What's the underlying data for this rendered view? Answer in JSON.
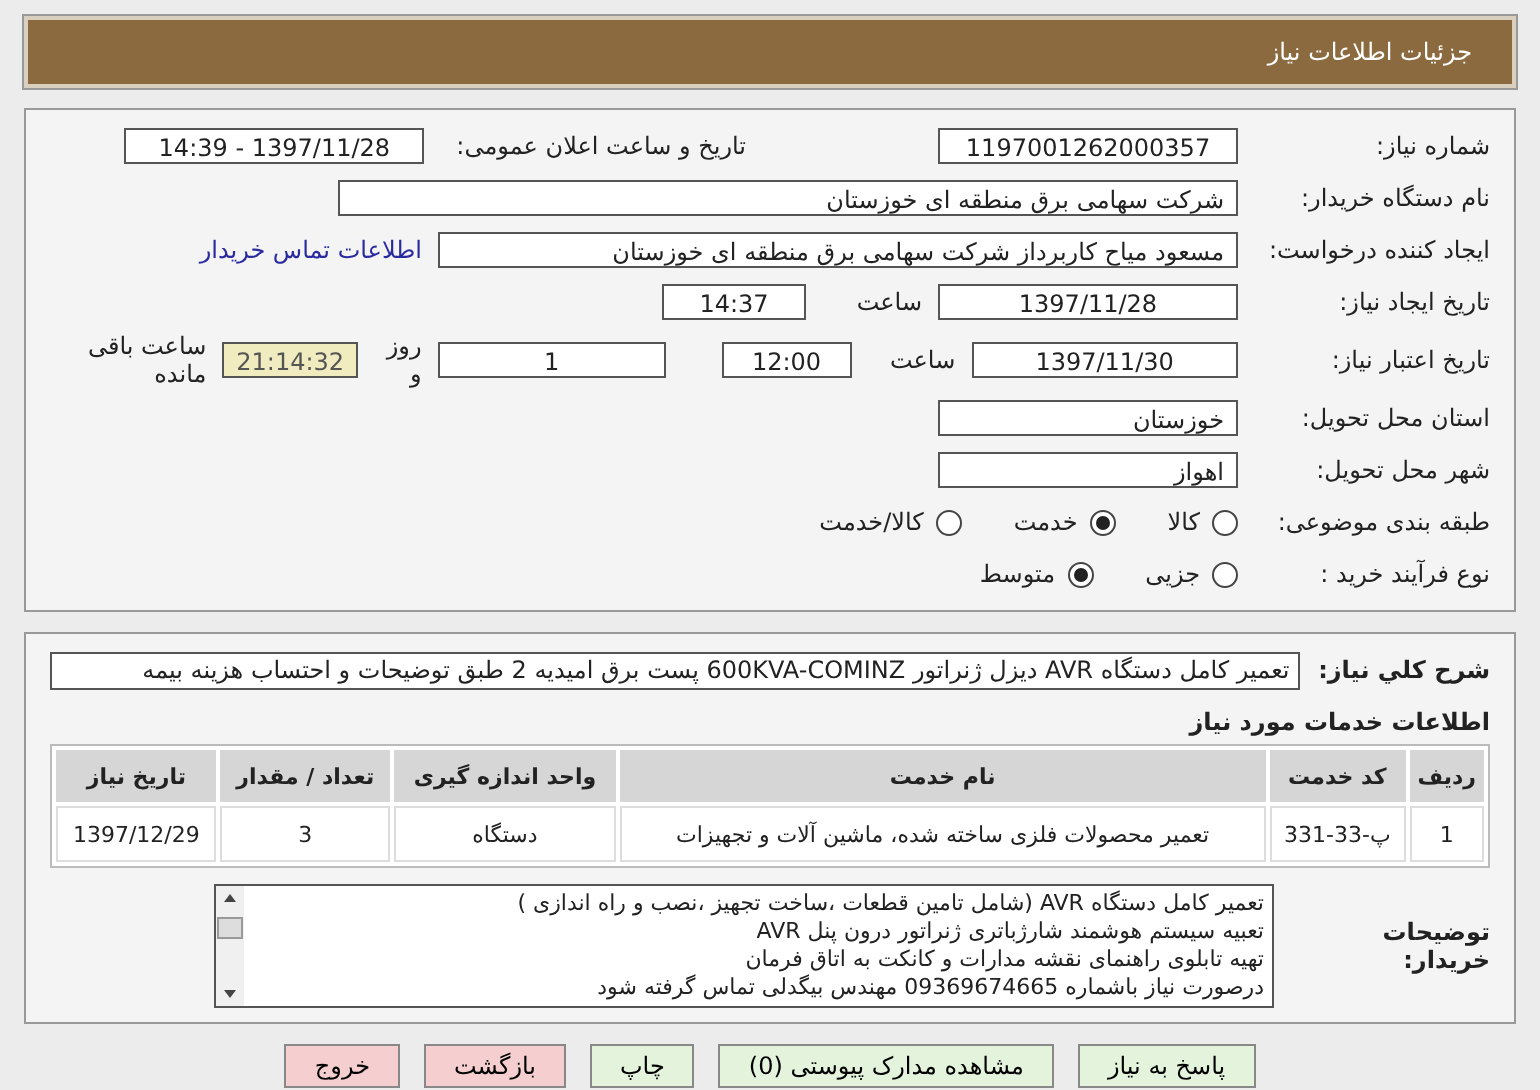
{
  "header": {
    "title": "جزئیات اطلاعات نیاز"
  },
  "need_number": {
    "label": "شماره نیاز:",
    "value": "1197001262000357"
  },
  "announce": {
    "label": "تاریخ و ساعت اعلان عمومی:",
    "value": "1397/11/28 - 14:39"
  },
  "buyer": {
    "label": "نام دستگاه خریدار:",
    "value": "شرکت سهامی برق منطقه ای خوزستان"
  },
  "requester": {
    "label": "ایجاد کننده درخواست:",
    "value": "مسعود میاح کاربرداز شرکت سهامی برق منطقه ای خوزستان",
    "link": "اطلاعات تماس خریدار"
  },
  "created": {
    "label": "تاریخ ایجاد نیاز:",
    "date": "1397/11/28",
    "time_label": "ساعت",
    "time": "14:37"
  },
  "validity": {
    "label": "تاریخ اعتبار نیاز:",
    "date": "1397/11/30",
    "time_label": "ساعت",
    "time": "12:00",
    "days": "1",
    "days_label": "روز و",
    "remaining": "21:14:32",
    "remaining_label": "ساعت باقی مانده"
  },
  "province": {
    "label": "استان محل تحویل:",
    "value": "خوزستان"
  },
  "city": {
    "label": "شهر محل تحویل:",
    "value": "اهواز"
  },
  "category": {
    "label": "طبقه بندی موضوعی:",
    "options": [
      {
        "label": "کالا",
        "selected": false
      },
      {
        "label": "خدمت",
        "selected": true
      },
      {
        "label": "کالا/خدمت",
        "selected": false
      }
    ]
  },
  "process": {
    "label": "نوع فرآیند خرید :",
    "options": [
      {
        "label": "جزیی",
        "selected": false
      },
      {
        "label": "متوسط",
        "selected": true
      }
    ]
  },
  "summary": {
    "label": "شرح کلي نیاز:",
    "value": "تعمیر کامل دستگاه AVR  دیزل ژنراتور 600KVA-COMINZ پست برق امیدیه  2 طبق توضیحات و احتساب هزینه بیمه"
  },
  "services": {
    "title": "اطلاعات خدمات مورد نیاز",
    "columns": [
      "ردیف",
      "کد خدمت",
      "نام خدمت",
      "واحد اندازه گیری",
      "تعداد / مقدار",
      "تاریخ نیاز"
    ],
    "rows": [
      [
        "1",
        "پ-33-331",
        "تعمیر محصولات فلزی ساخته شده، ماشین آلات و تجهیزات",
        "دستگاه",
        "3",
        "1397/12/29"
      ]
    ]
  },
  "buyer_notes": {
    "label": "توضیحات خریدار:",
    "lines": [
      "تعمیر کامل دستگاه AVR (شامل تامین قطعات ،ساخت تجهیز ،نصب و راه اندازی )",
      "تعبیه سیستم هوشمند شارژباتری ژنراتور درون پنل AVR",
      "تهیه تابلوی راهنمای نقشه مدارات و کانکت به اتاق فرمان",
      "درصورت نیاز باشماره 09369674665 مهندس بیگدلی تماس گرفته شود"
    ]
  },
  "buttons": [
    {
      "label": "پاسخ به نیاز",
      "kind": "normal"
    },
    {
      "label": "مشاهده مدارک پیوستی (0)",
      "kind": "normal"
    },
    {
      "label": "چاپ",
      "kind": "normal"
    },
    {
      "label": "بازگشت",
      "kind": "alert"
    },
    {
      "label": "خروج",
      "kind": "alert"
    }
  ]
}
